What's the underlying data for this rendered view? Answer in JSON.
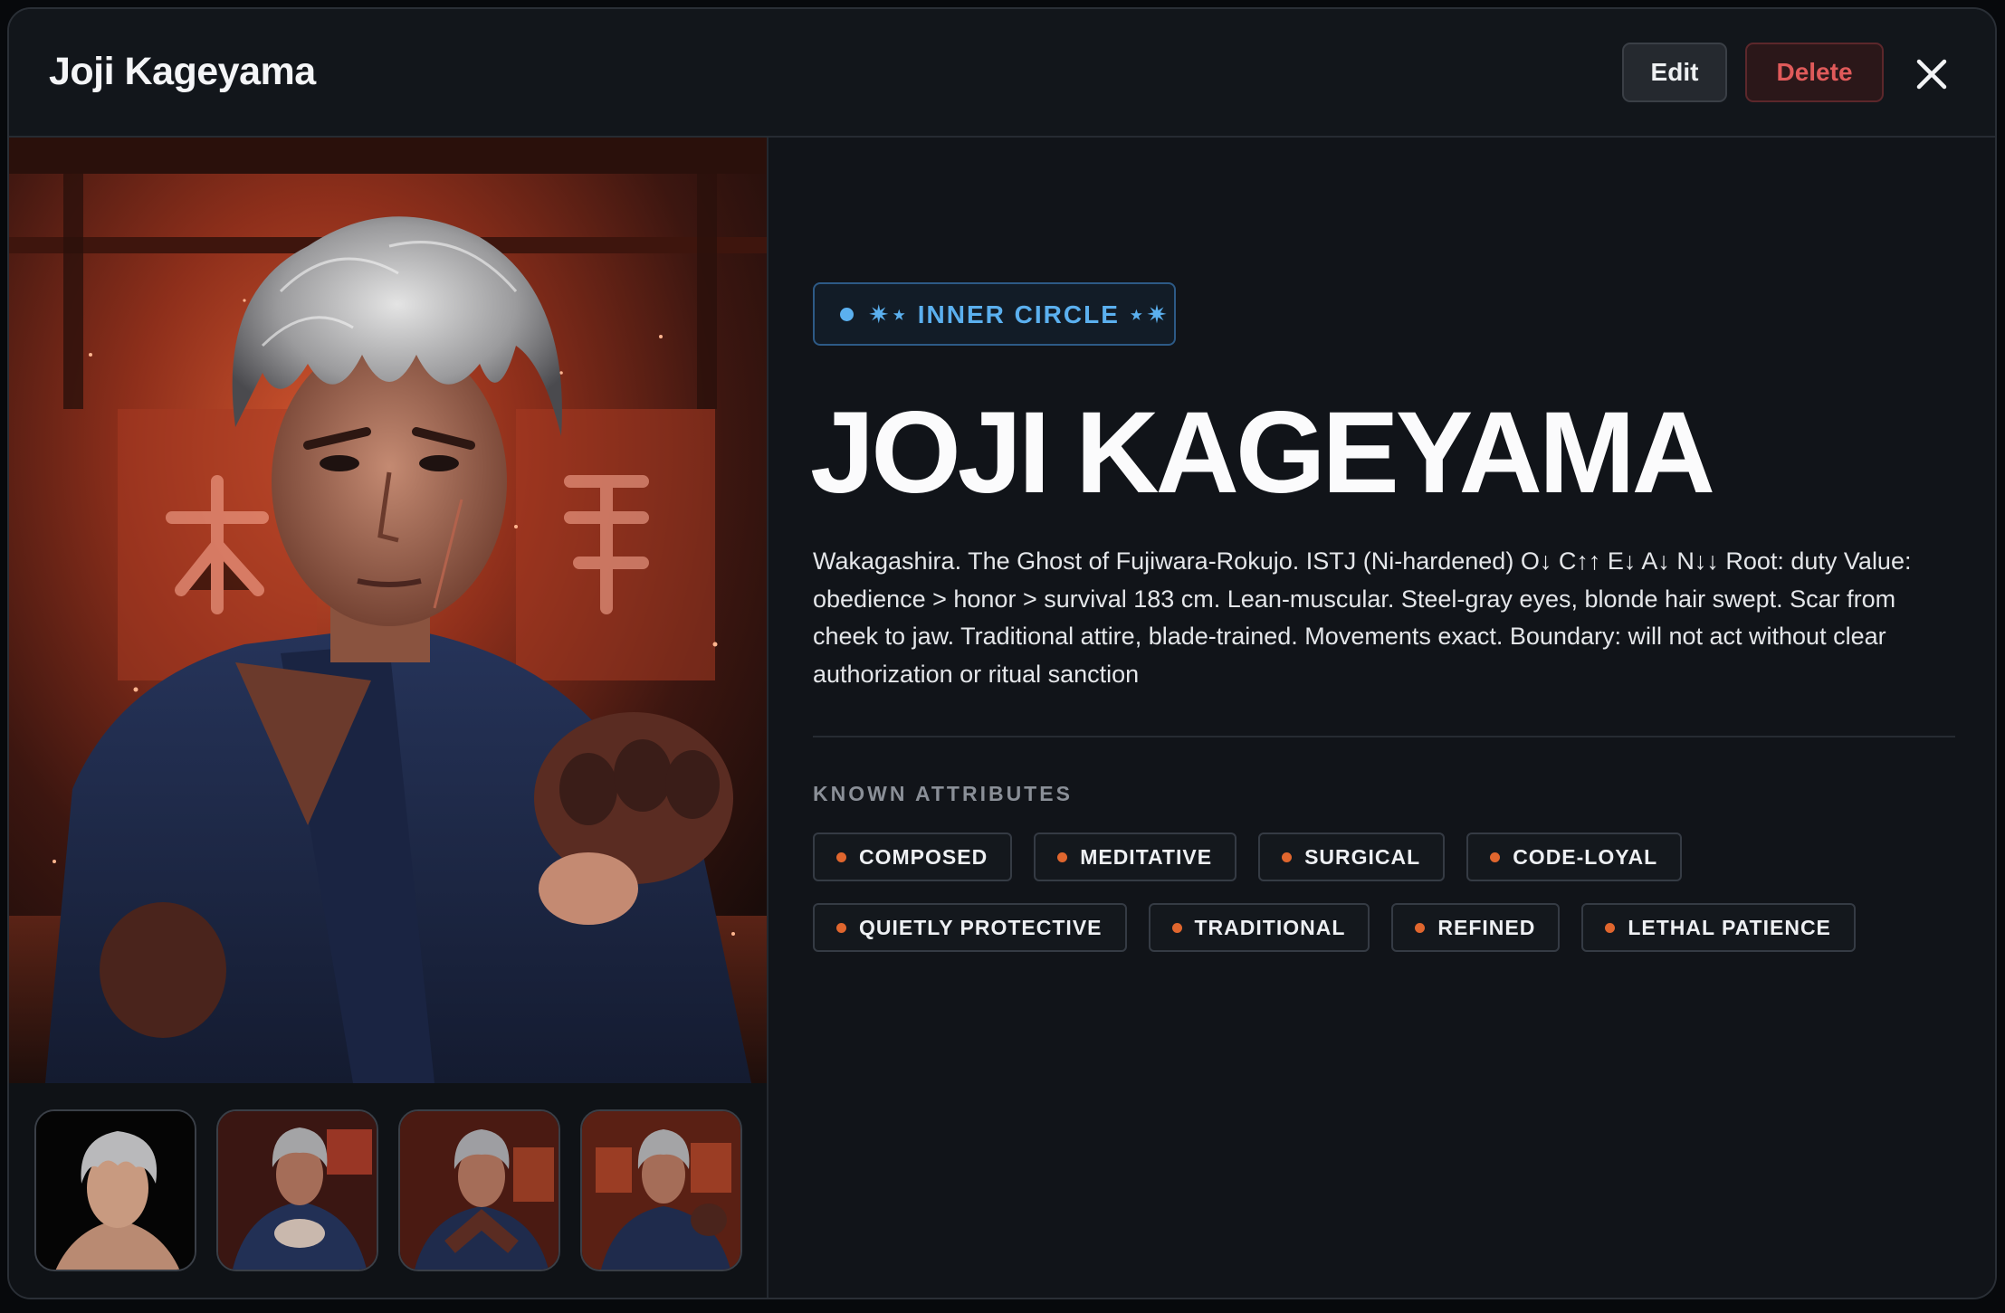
{
  "modal": {
    "title": "Joji Kageyama",
    "edit_label": "Edit",
    "delete_label": "Delete"
  },
  "profile": {
    "tier": "✷⋆ INNER CIRCLE ⋆✷",
    "name": "JOJI KAGEYAMA",
    "description": "Wakagashira. The Ghost of Fujiwara-Rokujo. ISTJ (Ni-hardened) O↓ C↑↑ E↓ A↓ N↓↓ Root: duty Value: obedience > honor > survival 183 cm. Lean-muscular. Steel-gray eyes, blonde hair swept. Scar from cheek to jaw. Traditional attire, blade-trained. Movements exact. Boundary: will not act without clear authorization or ritual sanction",
    "attributes_label": "KNOWN ATTRIBUTES",
    "attributes_row1": [
      "COMPOSED",
      "MEDITATIVE",
      "SURGICAL",
      "CODE-LOYAL"
    ],
    "attributes_row2": [
      "QUIETLY PROTECTIVE",
      "TRADITIONAL",
      "REFINED",
      "LETHAL PATIENCE"
    ]
  },
  "gallery": {
    "thumbnail_count": 4
  },
  "colors": {
    "accent_blue": "#5bb0ef",
    "accent_orange": "#e0662e",
    "danger": "#e05a5a"
  }
}
